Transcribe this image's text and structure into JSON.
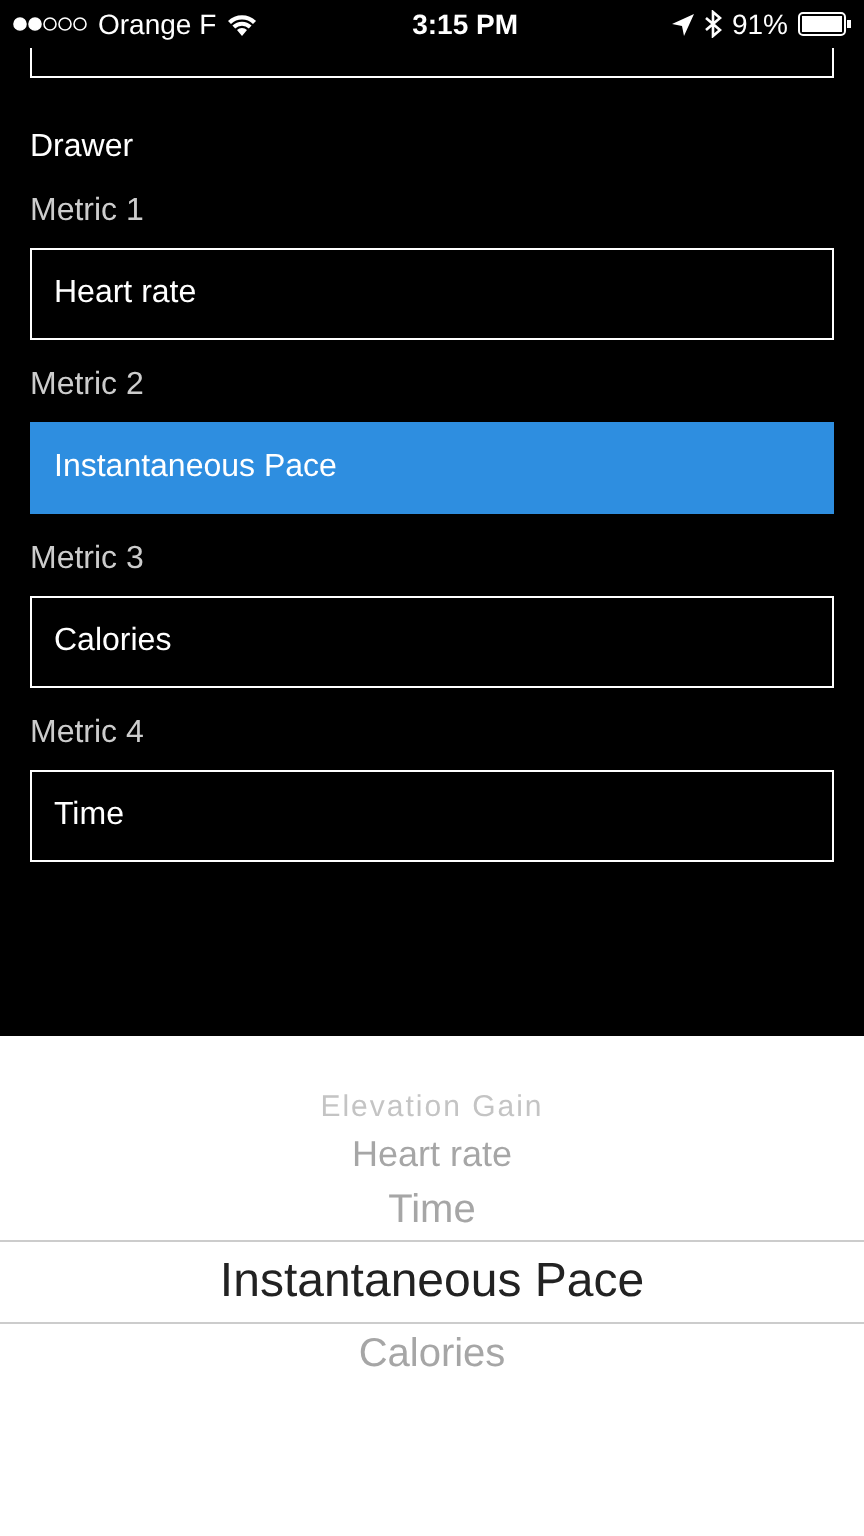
{
  "status_bar": {
    "carrier": "Orange F",
    "time": "3:15 PM",
    "battery": "91%"
  },
  "section_title": "Drawer",
  "metrics": [
    {
      "label": "Metric 1",
      "value": "Heart rate",
      "selected": false
    },
    {
      "label": "Metric 2",
      "value": "Instantaneous Pace",
      "selected": true
    },
    {
      "label": "Metric 3",
      "value": "Calories",
      "selected": false
    },
    {
      "label": "Metric 4",
      "value": "Time",
      "selected": false
    }
  ],
  "picker": [
    {
      "label": "Elevation Gain",
      "selected": false
    },
    {
      "label": "Heart rate",
      "selected": false
    },
    {
      "label": "Time",
      "selected": false
    },
    {
      "label": "Instantaneous Pace",
      "selected": true
    },
    {
      "label": "Calories",
      "selected": false
    }
  ]
}
